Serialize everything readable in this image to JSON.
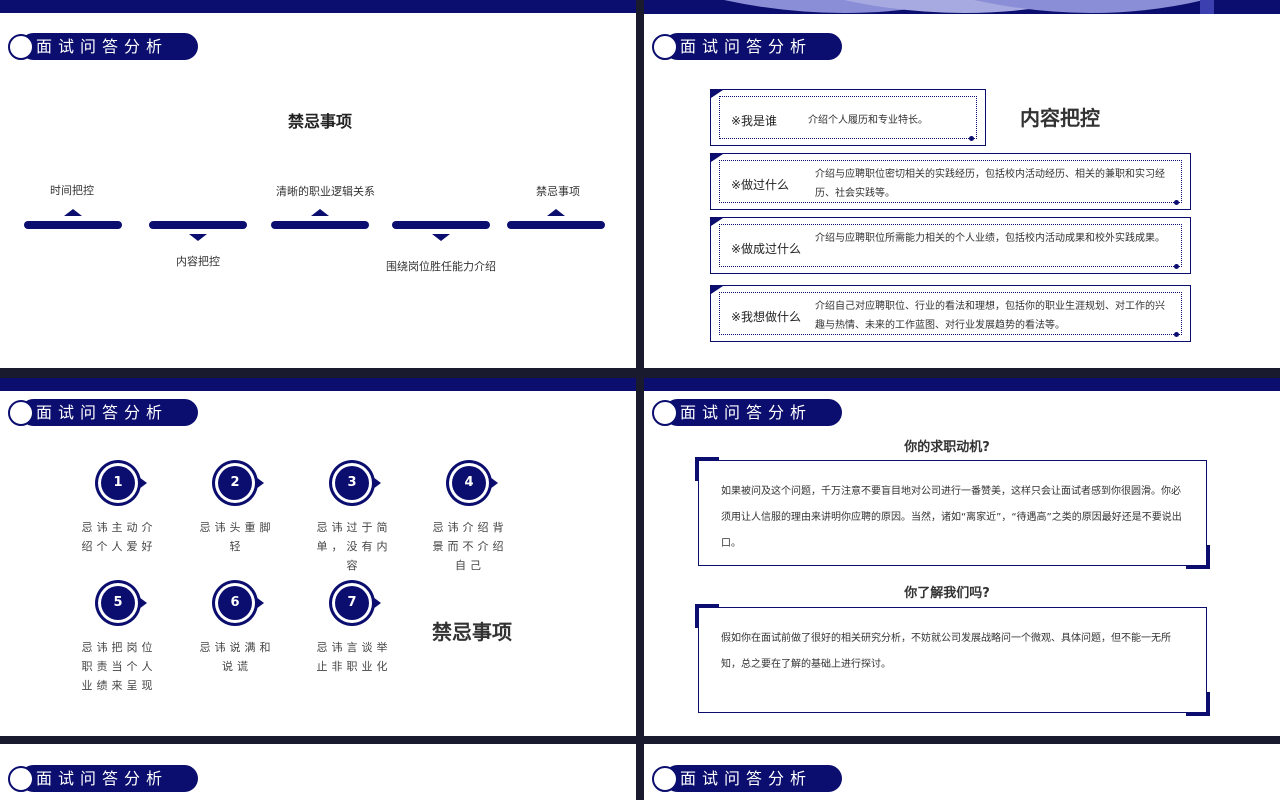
{
  "badge_label": "面试问答分析",
  "slide1": {
    "title": "禁忌事项",
    "top_labels": [
      "时间把控",
      "清晰的职业逻辑关系",
      "禁忌事项"
    ],
    "bottom_labels": [
      "内容把控",
      "围绕岗位胜任能力介绍"
    ]
  },
  "slide2": {
    "title": "内容把控",
    "cards": [
      {
        "q": "※我是谁",
        "desc": "介绍个人履历和专业特长。"
      },
      {
        "q": "※做过什么",
        "desc": "介绍与应聘职位密切相关的实践经历，包括校内活动经历、相关的兼职和实习经历、社会实践等。"
      },
      {
        "q": "※做成过什么",
        "desc": "介绍与应聘职位所需能力相关的个人业绩，包括校内活动成果和校外实践成果。"
      },
      {
        "q": "※我想做什么",
        "desc": "介绍自己对应聘职位、行业的看法和理想，包括你的职业生涯规划、对工作的兴趣与热情、未来的工作蓝图、对行业发展趋势的看法等。"
      }
    ]
  },
  "slide3": {
    "title": "禁忌事项",
    "items": [
      {
        "num": "1",
        "text": "忌讳主动介绍个人爱好"
      },
      {
        "num": "2",
        "text": "忌讳头重脚轻"
      },
      {
        "num": "3",
        "text": "忌讳过于简单，没有内容"
      },
      {
        "num": "4",
        "text": "忌讳介绍背景而不介绍自己"
      },
      {
        "num": "5",
        "text": "忌讳把岗位职责当个人业绩来呈现"
      },
      {
        "num": "6",
        "text": "忌讳说满和说谎"
      },
      {
        "num": "7",
        "text": "忌讳言谈举止非职业化"
      }
    ]
  },
  "slide4": {
    "q1": {
      "title": "你的求职动机?",
      "text": "如果被问及这个问题，千万注意不要盲目地对公司进行一番赞美，这样只会让面试者感到你很圆滑。你必须用让人信服的理由来讲明你应聘的原因。当然，诸如“离家近”，“待遇高”之类的原因最好还是不要说出口。"
    },
    "q2": {
      "title": "你了解我们吗?",
      "text": "假如你在面试前做了很好的相关研究分析，不妨就公司发展战略问一个微观、具体问题，但不能一无所知，总之要在了解的基础上进行探讨。"
    }
  },
  "colors": {
    "accent": "#0b0e6e",
    "background": "#ffffff",
    "gap": "#1a1a2e"
  }
}
